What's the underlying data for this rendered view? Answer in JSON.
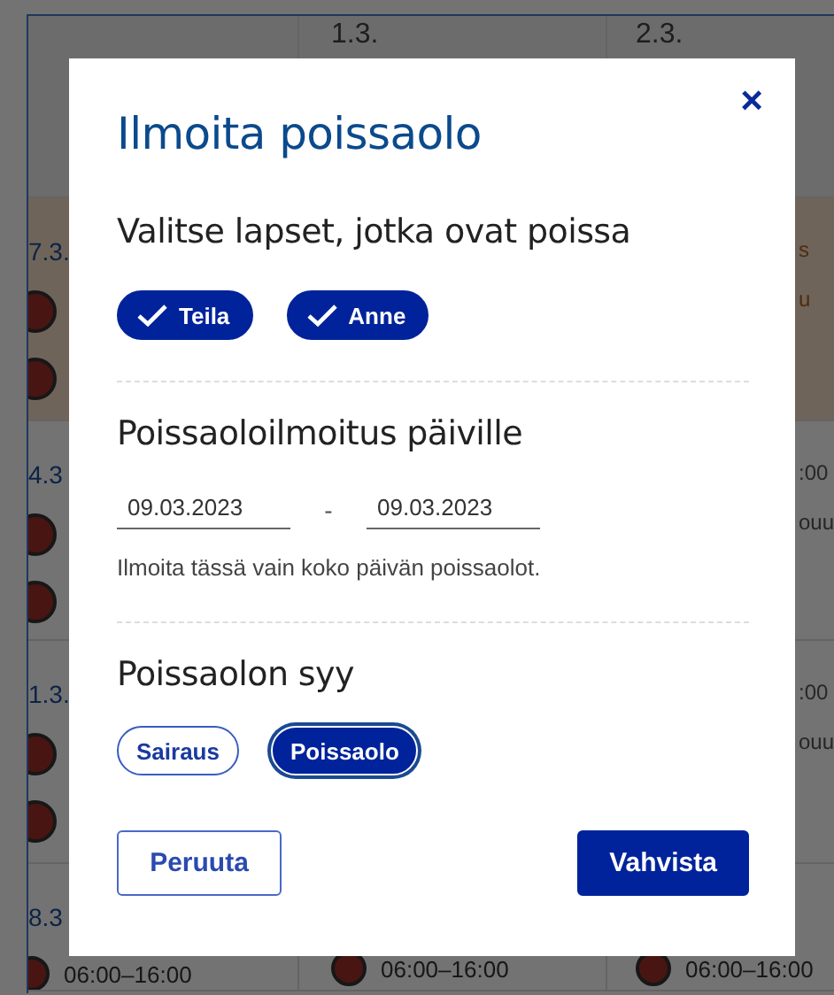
{
  "calendar": {
    "rows": [
      {
        "highlighted": false,
        "cells": [
          {},
          {
            "date": "1.3."
          },
          {
            "date": "2.3."
          }
        ]
      },
      {
        "highlighted": true,
        "cells": [
          {
            "date": "7.3.",
            "items": [
              {
                "kind": "avatar"
              },
              {
                "kind": "avatar"
              }
            ]
          },
          {},
          {
            "items": [
              {
                "kind": "text",
                "text": "s"
              },
              {
                "kind": "text",
                "text": "u"
              }
            ]
          }
        ]
      },
      {
        "highlighted": false,
        "cells": [
          {
            "date": "4.3",
            "items": [
              {
                "kind": "avatar"
              },
              {
                "kind": "avatar"
              }
            ]
          },
          {},
          {
            "items": [
              {
                "kind": "text",
                "text": ":00"
              },
              {
                "kind": "text",
                "text": "ouu"
              }
            ]
          }
        ]
      },
      {
        "highlighted": false,
        "cells": [
          {
            "date": "1.3.",
            "items": [
              {
                "kind": "avatar"
              },
              {
                "kind": "avatar"
              }
            ]
          },
          {},
          {
            "items": [
              {
                "kind": "text",
                "text": ":00"
              },
              {
                "kind": "text",
                "text": "ouu"
              }
            ]
          }
        ]
      },
      {
        "highlighted": false,
        "cells": [
          {
            "date": "8.3",
            "items": [
              {
                "kind": "shift",
                "time": "06:00–16:00"
              }
            ]
          },
          {
            "items": [
              {
                "kind": "shift",
                "time": "06:00–16:00"
              }
            ]
          },
          {
            "items": [
              {
                "kind": "shift",
                "time": "06:00–16:00"
              }
            ]
          }
        ]
      }
    ]
  },
  "dialog": {
    "title": "Ilmoita poissaolo",
    "close": "×",
    "children_heading": "Valitse lapset, jotka ovat poissa",
    "children": [
      {
        "name": "Teila",
        "selected": true
      },
      {
        "name": "Anne",
        "selected": true
      }
    ],
    "dates_heading": "Poissaoloilmoitus päiville",
    "start_date": "09.03.2023",
    "separator": "-",
    "end_date": "09.03.2023",
    "hint": "Ilmoita tässä vain koko päivän poissaolot.",
    "reason_heading": "Poissaolon syy",
    "reasons": [
      {
        "label": "Sairaus",
        "selected": false
      },
      {
        "label": "Poissaolo",
        "selected": true
      }
    ],
    "cancel": "Peruuta",
    "confirm": "Vahvista"
  }
}
